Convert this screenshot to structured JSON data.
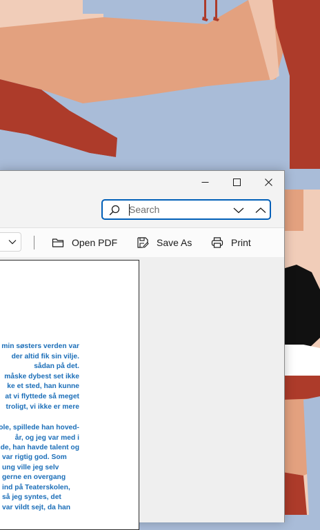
{
  "window": {
    "controls": {
      "minimize": "minimize",
      "maximize": "maximize",
      "close": "close"
    }
  },
  "search": {
    "placeholder": "Search",
    "value": ""
  },
  "toolbar": {
    "open_label": "Open PDF",
    "save_label": "Save As",
    "print_label": "Print"
  },
  "document": {
    "para1": [
      "min søsters verden var",
      "der altid fik sin vilje.",
      "sådan på det.",
      "måske dybest set ikke",
      "ke et sted, han kunne",
      "at vi flyttede så meget",
      "troligt, vi ikke er mere"
    ],
    "para2": [
      "ole, spillede han hoved-",
      "år, og jeg var med i",
      "de, han havde talent og"
    ],
    "para3": [
      "var rigtig god. Som",
      "ung ville jeg selv",
      "gerne en overgang",
      "ind på Teaterskolen,",
      "så jeg syntes, det",
      "var vildt sejt, da han"
    ]
  },
  "colors": {
    "accent": "#005fb8",
    "document_text": "#1b6eb8",
    "wallpaper_peach": "#e3a17f",
    "wallpaper_red": "#ad3b2a",
    "wallpaper_blue": "#a9bcd8"
  },
  "icons": {
    "search": "search-icon",
    "previous": "chevron-down-icon",
    "next": "chevron-up-icon",
    "open": "folder-icon",
    "save": "save-as-icon",
    "print": "printer-icon"
  }
}
